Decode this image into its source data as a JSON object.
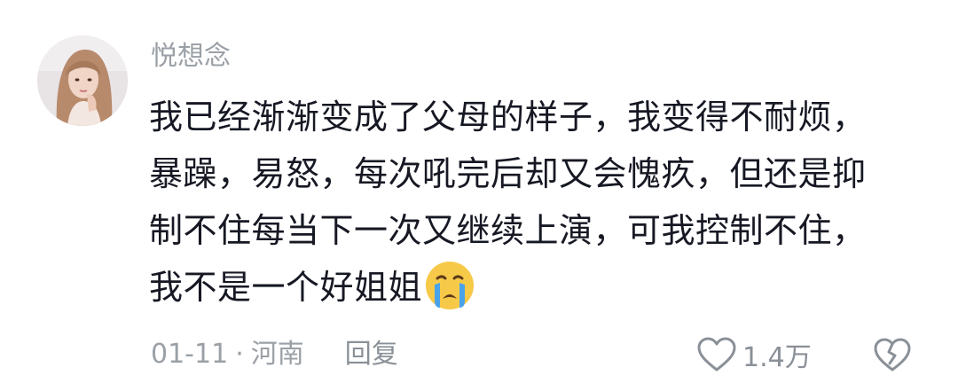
{
  "comment": {
    "username": "悦想念",
    "text_lines": [
      "我已经渐渐变成了父母的样子，我变得不耐烦，",
      "暴躁，易怒，每次吼完后却又会愧疚，但还是抑",
      "制不住每当下一次又继续上演，可我控制不住，",
      "我不是一个好姐姐"
    ],
    "emoji": "loudly-crying-face",
    "date": "01-11",
    "separator": "·",
    "location": "河南",
    "reply_label": "回复",
    "like_count": "1.4万"
  },
  "colors": {
    "text": "#161823",
    "muted": "#9aa0a6",
    "icon": "#8a9097",
    "emoji_face": "#f7c948",
    "emoji_tears": "#4aa3e8"
  }
}
